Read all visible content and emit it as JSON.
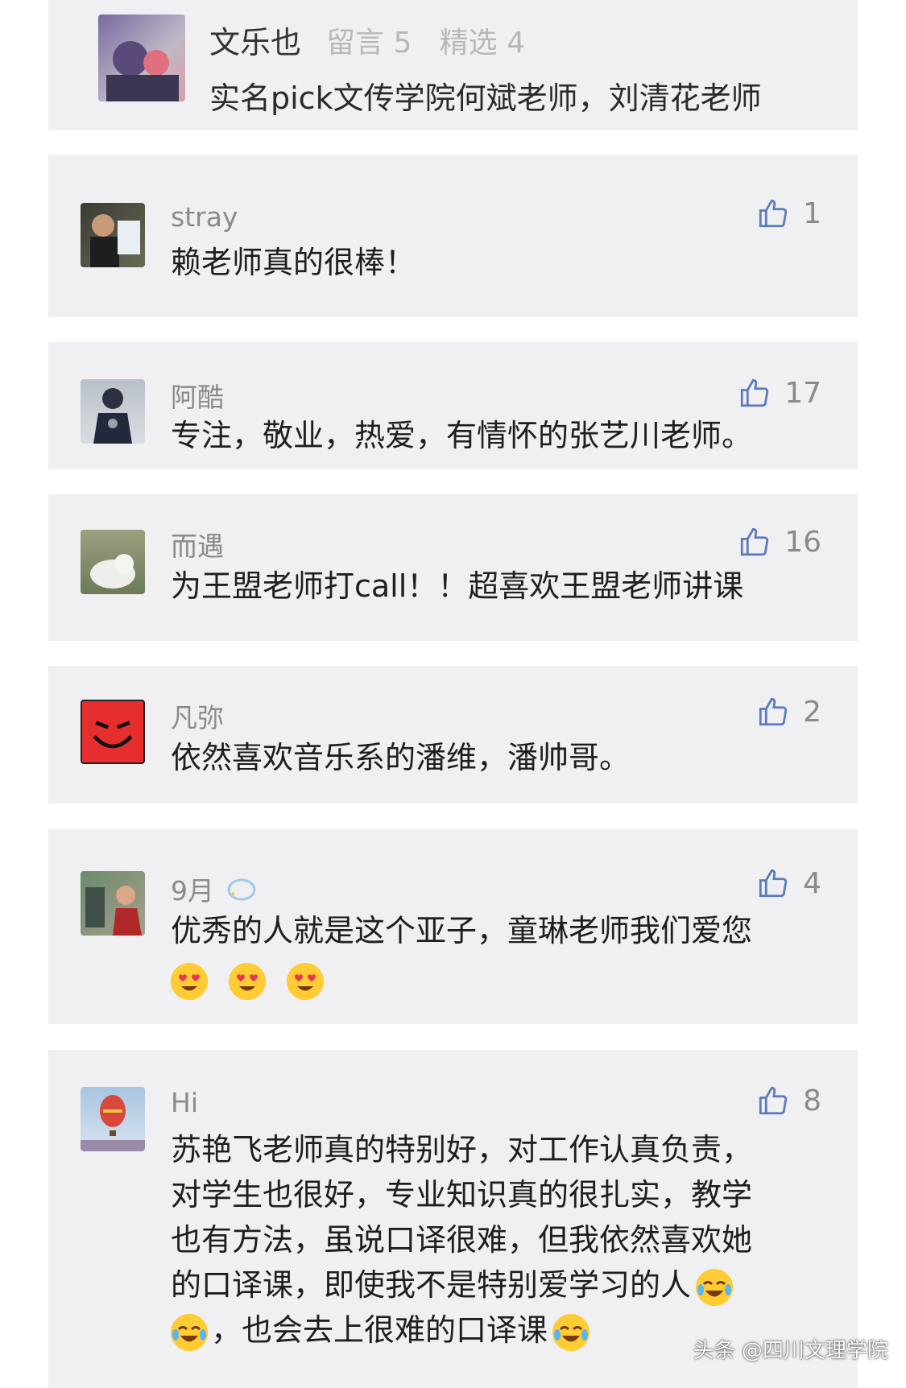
{
  "top_card": {
    "name": "文乐也",
    "stats": "留言 5   精选 4",
    "text": "实名pick文传学院何斌老师，刘清花老师"
  },
  "comments": [
    {
      "name": "stray",
      "likes": "1",
      "lines": [
        "赖老师真的很棒！"
      ]
    },
    {
      "name": "阿酷",
      "likes": "17",
      "lines": [
        "专注，敬业，热爱，有情怀的张艺川老师。"
      ]
    },
    {
      "name": "而遇",
      "likes": "16",
      "lines": [
        "为王盟老师打call！！超喜欢王盟老师讲课"
      ]
    },
    {
      "name": "凡弥",
      "likes": "2",
      "lines": [
        "依然喜欢音乐系的潘维，潘帅哥。"
      ]
    },
    {
      "name": "9月",
      "likes": "4",
      "lines": [
        "优秀的人就是这个亚子，童琳老师我们爱您"
      ]
    },
    {
      "name": "Hi",
      "likes": "8",
      "lines": [
        "苏艳飞老师真的特别好，对工作认真负责，",
        "对学生也很好，专业知识真的很扎实，教学",
        "也有方法，虽说口译很难，但我依然喜欢她",
        "的口译课，即使我不是特别爱学习的人",
        "，也会去上很难的口译课"
      ]
    }
  ],
  "watermark": "头条 @四川文理学院",
  "colors": {
    "card_bg": "#f0f0f2",
    "text": "#1e1e1e",
    "muted": "#8a8a8a",
    "emoji": "#ffcc33",
    "angry_avatar": "#e62e2e"
  }
}
